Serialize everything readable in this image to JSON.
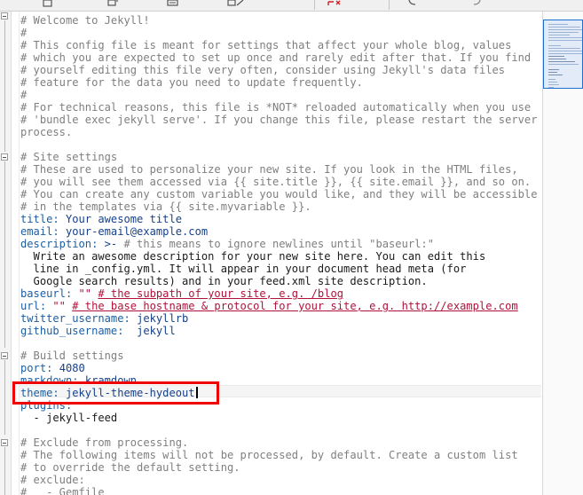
{
  "colors": {
    "comment": "#7f7f7f",
    "key": "#1c5ea3",
    "value": "#17408a",
    "string": "#b0123a",
    "highlight_border": "#ee0000",
    "minimap_viewport": "#1f6fd0"
  },
  "toolbar": {
    "icons": [
      "document-icon",
      "paste-icon",
      "save-icon",
      "edit-icon",
      "cut-icon",
      "undo-icon",
      "redo-icon"
    ]
  },
  "editor": {
    "language": "YAML",
    "lines": {
      "l1": "# Welcome to Jekyll!",
      "l2": "#",
      "l3": "# This config file is meant for settings that affect your whole blog, values",
      "l4": "# which you are expected to set up once and rarely edit after that. If you find",
      "l5": "# yourself editing this file very often, consider using Jekyll's data files",
      "l6": "# feature for the data you need to update frequently.",
      "l7": "#",
      "l8": "# For technical reasons, this file is *NOT* reloaded automatically when you use",
      "l9": "# 'bundle exec jekyll serve'. If you change this file, please restart the server",
      "l10": "process.",
      "l11": "",
      "l12": "# Site settings",
      "l13": "# These are used to personalize your new site. If you look in the HTML files,",
      "l14": "# you will see them accessed via {{ site.title }}, {{ site.email }}, and so on.",
      "l15": "# You can create any custom variable you would like, and they will be accessible",
      "l16": "# in the templates via {{ site.myvariable }}.",
      "title_key": "title:",
      "title_val": "Your awesome title",
      "email_key": "email:",
      "email_val": "your-email@example.com",
      "desc_key": "description:",
      "desc_op": ">-",
      "desc_cmt": "# this means to ignore newlines until \"baseurl:\"",
      "desc1": "  Write an awesome description for your new site here. You can edit this",
      "desc2": "  line in _config.yml. It will appear in your document head meta (for",
      "desc3": "  Google search results) and in your feed.xml site description.",
      "baseurl_key": "baseurl:",
      "baseurl_val": "\"\"",
      "baseurl_cmt": "# the subpath of your site, e.g. /blog",
      "url_key": "url:",
      "url_val": "\"\"",
      "url_cmt": "# the base hostname & protocol for your site, e.g. http://example.com",
      "twitter_key": "twitter_username:",
      "twitter_val": "jekyllrb",
      "github_key": "github_username:",
      "github_val": "jekyll",
      "build_cmt": "# Build settings",
      "port_key": "port:",
      "port_val": "4080",
      "markdown_key": "markdown:",
      "markdown_val": "kramdown",
      "theme_key": "theme:",
      "theme_val": "jekyll-theme-hydeout",
      "plugins_key": "plugins:",
      "plugin1": "  - jekyll-feed",
      "excl1": "# Exclude from processing.",
      "excl2": "# The following items will not be processed, by default. Create a custom list",
      "excl3": "# to override the default setting.",
      "excl4": "# exclude:",
      "excl5": "#   - Gemfile"
    }
  }
}
